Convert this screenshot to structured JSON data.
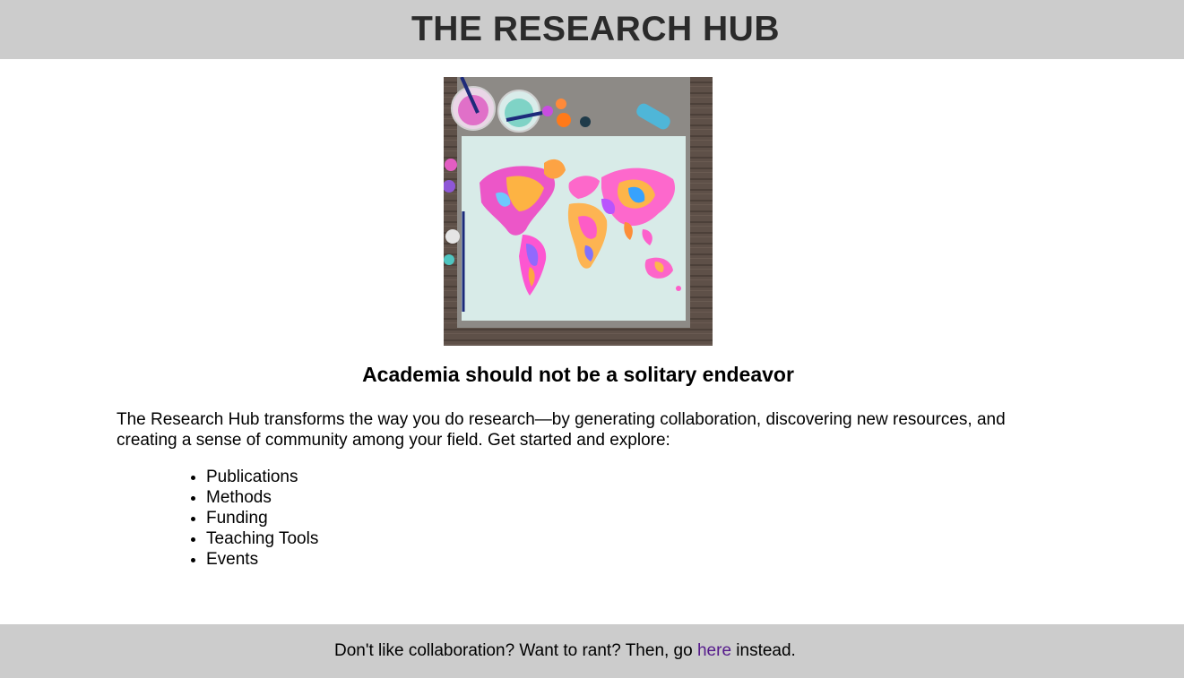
{
  "header": {
    "title": "THE RESEARCH HUB"
  },
  "hero_image": {
    "description_icon": "watercolor-world-map-image"
  },
  "main": {
    "tagline": "Academia should not be a solitary endeavor",
    "intro": "The Research Hub transforms the way you do research—by generating collaboration, discovering new resources, and creating a sense of community among your field. Get started and explore:",
    "explore_items": [
      "Publications",
      "Methods",
      "Funding",
      "Teaching Tools",
      "Events"
    ]
  },
  "footer": {
    "text_before": "Don't like collaboration? Want to rant? Then, go ",
    "link_label": "here",
    "text_after": " instead."
  },
  "colors": {
    "header_bg": "#cccccc",
    "footer_bg": "#cccccc",
    "link": "#551a8b"
  }
}
